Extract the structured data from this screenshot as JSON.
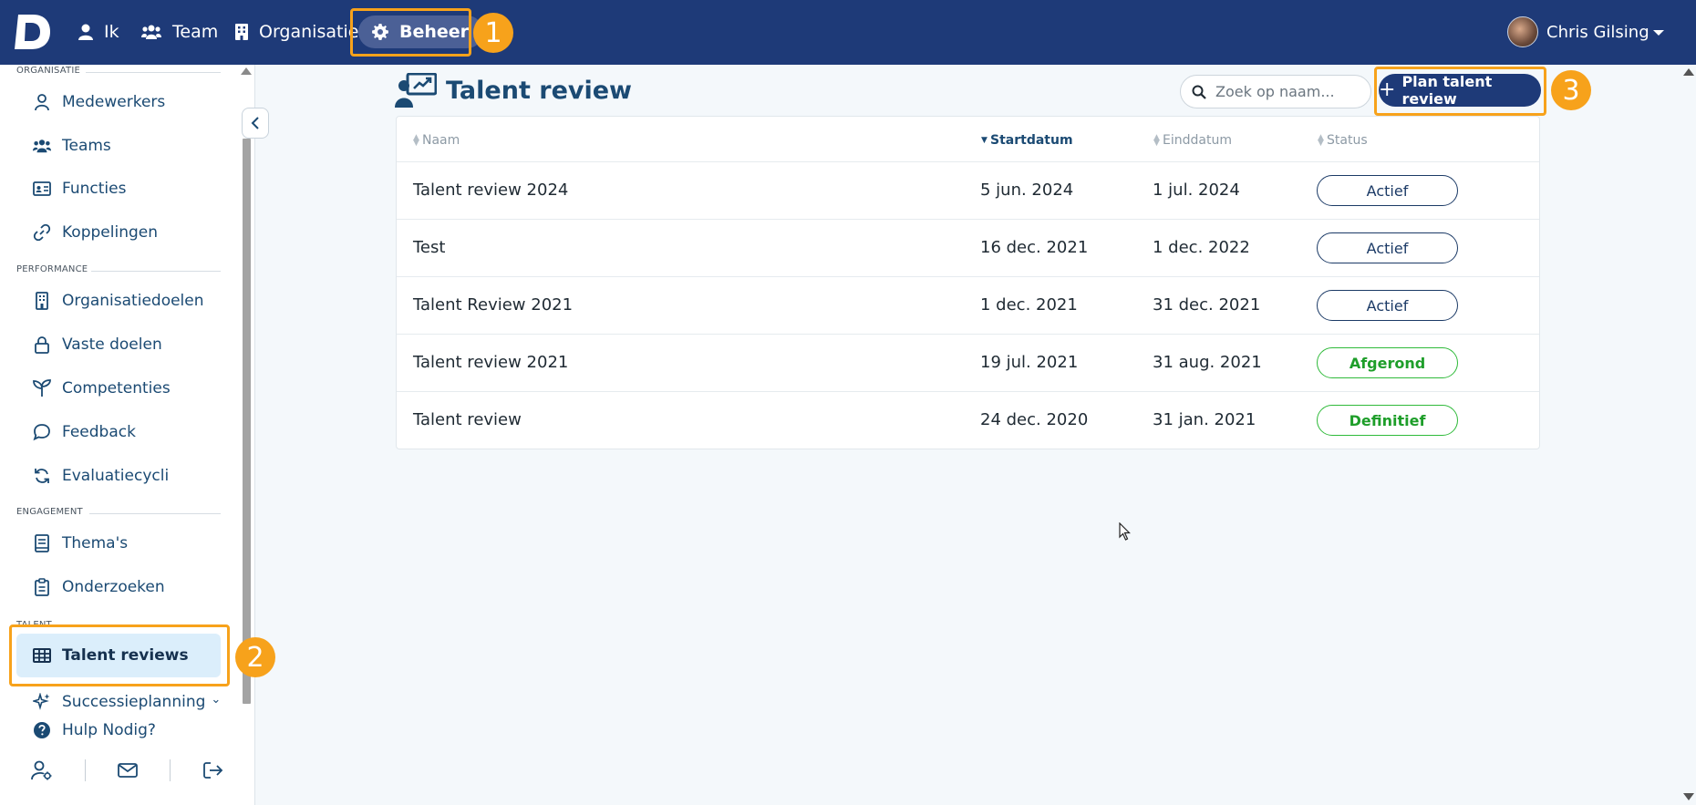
{
  "topnav": {
    "logo": "D",
    "items": [
      {
        "label": "Ik",
        "icon": "user-icon"
      },
      {
        "label": "Team",
        "icon": "users-icon"
      },
      {
        "label": "Organisatie",
        "icon": "building-icon"
      },
      {
        "label": "Beheer",
        "icon": "gear-icon",
        "active": true
      }
    ],
    "user_name": "Chris Gilsing"
  },
  "sidebar": {
    "sections": [
      {
        "heading": "ORGANISATIE",
        "items": [
          {
            "label": "Medewerkers",
            "icon": "person-icon"
          },
          {
            "label": "Teams",
            "icon": "users-icon"
          },
          {
            "label": "Functies",
            "icon": "id-card-icon"
          },
          {
            "label": "Koppelingen",
            "icon": "link-icon"
          }
        ]
      },
      {
        "heading": "PERFORMANCE",
        "items": [
          {
            "label": "Organisatiedoelen",
            "icon": "building-icon"
          },
          {
            "label": "Vaste doelen",
            "icon": "lock-icon"
          },
          {
            "label": "Competenties",
            "icon": "sprout-icon"
          },
          {
            "label": "Feedback",
            "icon": "chat-bubble-icon"
          },
          {
            "label": "Evaluatiecycli",
            "icon": "refresh-icon"
          }
        ]
      },
      {
        "heading": "ENGAGEMENT",
        "items": [
          {
            "label": "Thema's",
            "icon": "book-icon"
          },
          {
            "label": "Onderzoeken",
            "icon": "clipboard-icon"
          }
        ]
      },
      {
        "heading": "TALENT",
        "items": [
          {
            "label": "Talent reviews",
            "icon": "table-icon",
            "active": true
          },
          {
            "label": "Successieplanning",
            "icon": "sparkles-icon"
          }
        ]
      }
    ],
    "help_label": "Hulp Nodig?"
  },
  "main": {
    "title": "Talent review",
    "search_placeholder": "Zoek op naam...",
    "plan_button": "Plan talent review",
    "columns": [
      "Naam",
      "Startdatum",
      "Einddatum",
      "Status"
    ],
    "sorted_column": "Startdatum",
    "rows": [
      {
        "naam": "Talent review 2024",
        "start": "5 jun. 2024",
        "eind": "1 jul. 2024",
        "status": "Actief"
      },
      {
        "naam": "Test",
        "start": "16 dec. 2021",
        "eind": "1 dec. 2022",
        "status": "Actief"
      },
      {
        "naam": "Talent Review 2021",
        "start": "1 dec. 2021",
        "eind": "31 dec. 2021",
        "status": "Actief"
      },
      {
        "naam": "Talent review 2021",
        "start": "19 jul. 2021",
        "eind": "31 aug. 2021",
        "status": "Afgerond"
      },
      {
        "naam": "Talent review",
        "start": "24 dec. 2020",
        "eind": "31 jan. 2021",
        "status": "Definitief"
      }
    ]
  },
  "annotations": {
    "steps": [
      "1",
      "2",
      "3"
    ],
    "color": "#f7a21b"
  },
  "colors": {
    "topbar": "#1e3a78",
    "primary": "#1b4a73",
    "status_active": "#1b3a66",
    "status_done": "#2fba3a"
  }
}
